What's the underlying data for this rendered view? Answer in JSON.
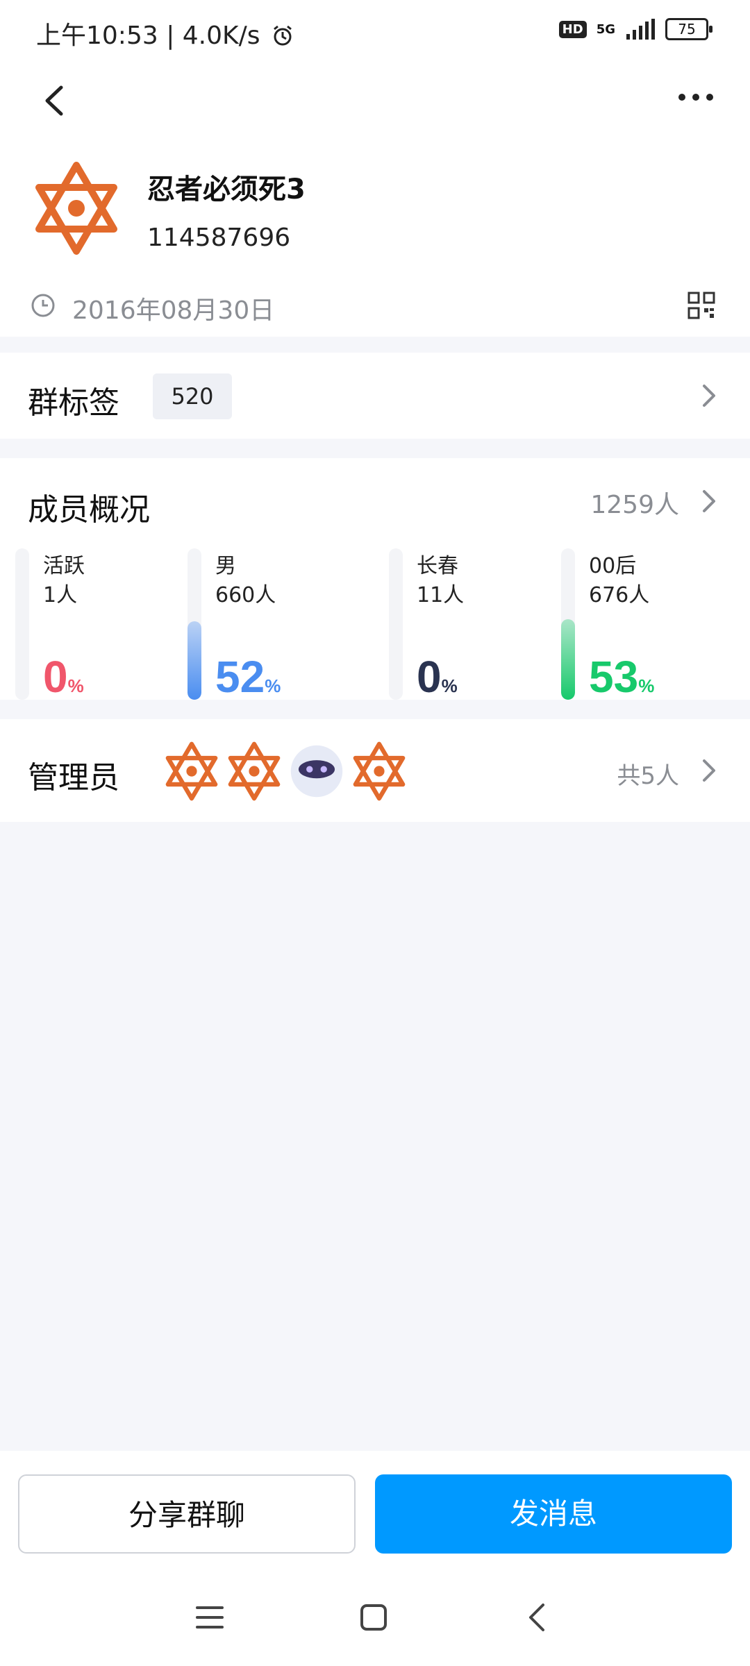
{
  "status_bar": {
    "time_speed": "上午10:53 | 4.0K/s",
    "network": "5G",
    "hd": "HD",
    "battery": "75"
  },
  "header": {
    "group_name": "忍者必须死3",
    "group_id": "114587696",
    "create_date": "2016年08月30日"
  },
  "tags": {
    "title": "群标签",
    "chip": "520"
  },
  "members": {
    "title": "成员概况",
    "total": "1259人",
    "stats": [
      {
        "label": "活跃",
        "count": "1人",
        "value": "0",
        "unit": "%",
        "fraction": 0.0,
        "color": "#f0566b"
      },
      {
        "label": "男",
        "count": "660人",
        "value": "52",
        "unit": "%",
        "fraction": 0.52,
        "color": "#4a8df0"
      },
      {
        "label": "长春",
        "count": "11人",
        "value": "0",
        "unit": "%",
        "fraction": 0.0,
        "color": "#2a3350"
      },
      {
        "label": "00后",
        "count": "676人",
        "value": "53",
        "unit": "%",
        "fraction": 0.53,
        "color": "#17c96b"
      }
    ]
  },
  "admins": {
    "title": "管理员",
    "count": "共5人",
    "avatars": [
      "star-emblem-icon",
      "star-emblem-icon",
      "robot-avatar-icon",
      "star-emblem-icon"
    ]
  },
  "actions": {
    "share": "分享群聊",
    "message": "发消息"
  }
}
